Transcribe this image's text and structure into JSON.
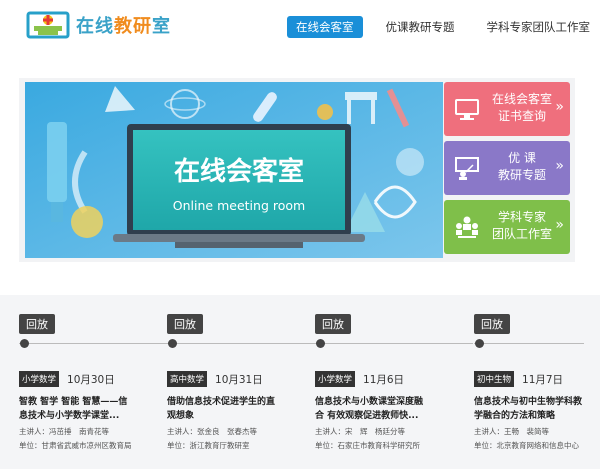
{
  "logo": {
    "part1": "在线",
    "part2": "教研",
    "part3": "室"
  },
  "nav": [
    {
      "label": "在线会客室",
      "active": true
    },
    {
      "label": "优课教研专题",
      "active": false
    },
    {
      "label": "学科专家团队工作室",
      "active": false
    }
  ],
  "banner": {
    "title": "在线会客室",
    "subtitle": "Online meeting room"
  },
  "side_buttons": [
    {
      "label": "在线会客室\n证书查询",
      "arrow": "»",
      "icon": "monitor-icon",
      "color": "#ef6f7d"
    },
    {
      "label": "优 课\n教研专题",
      "arrow": "»",
      "icon": "teacher-icon",
      "color": "#8a78c8"
    },
    {
      "label": "学科专家\n团队工作室",
      "arrow": "»",
      "icon": "team-icon",
      "color": "#7fbf4a"
    }
  ],
  "events": [
    {
      "button": "回放",
      "tag": "小学数学",
      "date": "10月30日",
      "title": "智教 智学 智能 智慧——信\n息技术与小学数学课堂...",
      "speaker": "主讲人：冯茁捶　南青花等",
      "unit": "单位：甘肃省武威市凉州区教育局"
    },
    {
      "button": "回放",
      "tag": "高中数学",
      "date": "10月31日",
      "title": "借助信息技术促进学生的直\n观想象",
      "speaker": "主讲人：张金良　张春杰等",
      "unit": "单位：浙江教育厅教研室"
    },
    {
      "button": "回放",
      "tag": "小学数学",
      "date": "11月6日",
      "title": "信息技术与小数课堂深度融\n合 有效观察促进教师快...",
      "speaker": "主讲人：宋　辉　杨廷分等",
      "unit": "单位：石家庄市教育科学研究所"
    },
    {
      "button": "回放",
      "tag": "初中生物",
      "date": "11月7日",
      "title": "信息技术与初中生物学科教\n学融合的方法和策略",
      "speaker": "主讲人：王畅　裴简等",
      "unit": "单位：北京教育网络和信息中心"
    }
  ]
}
